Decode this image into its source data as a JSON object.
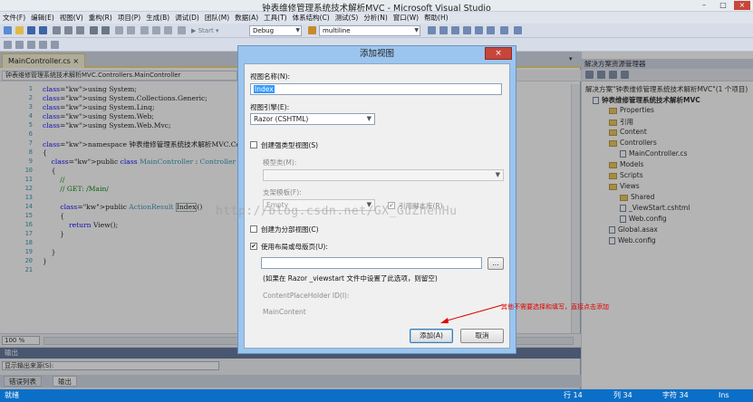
{
  "window": {
    "title": "钟表维修管理系统技术解析MVC - Microsoft Visual Studio",
    "min": "–",
    "max": "□",
    "close": "×"
  },
  "menu": [
    "文件(F)",
    "编辑(E)",
    "视图(V)",
    "重构(R)",
    "项目(P)",
    "生成(B)",
    "调试(D)",
    "团队(M)",
    "数据(A)",
    "工具(T)",
    "体系结构(C)",
    "测试(S)",
    "分析(N)",
    "窗口(W)",
    "帮助(H)"
  ],
  "toolbar": {
    "start_label": "Start",
    "config": "Debug",
    "search": "multiline"
  },
  "editor": {
    "tab_label": "MainController.cs",
    "nav_combo": "钟表维修管理系统技术解析MVC.Controllers.MainController",
    "zoom": "100 %",
    "lines": [
      {
        "n": "1",
        "t": "using System;"
      },
      {
        "n": "2",
        "t": "using System.Collections.Generic;"
      },
      {
        "n": "3",
        "t": "using System.Linq;"
      },
      {
        "n": "4",
        "t": "using System.Web;"
      },
      {
        "n": "5",
        "t": "using System.Web.Mvc;"
      },
      {
        "n": "6",
        "t": ""
      },
      {
        "n": "7",
        "t": "namespace 钟表维修管理系统技术解析MVC.Controllers"
      },
      {
        "n": "8",
        "t": "{"
      },
      {
        "n": "9",
        "t": "    public class MainController : Controller"
      },
      {
        "n": "10",
        "t": "    {"
      },
      {
        "n": "11",
        "t": "        //"
      },
      {
        "n": "12",
        "t": "        // GET: /Main/"
      },
      {
        "n": "13",
        "t": ""
      },
      {
        "n": "14",
        "t": "        public ActionResult Index()"
      },
      {
        "n": "15",
        "t": "        {"
      },
      {
        "n": "16",
        "t": "            return View();"
      },
      {
        "n": "17",
        "t": "        }"
      },
      {
        "n": "18",
        "t": ""
      },
      {
        "n": "19",
        "t": "    }"
      },
      {
        "n": "20",
        "t": "}"
      },
      {
        "n": "21",
        "t": ""
      }
    ]
  },
  "output": {
    "header": "输出",
    "source_label": "显示输出来源(S):",
    "tabs": [
      "错误列表",
      "输出"
    ]
  },
  "status": {
    "left": "就绪",
    "row": "行 14",
    "col": "列 34",
    "char": "字符 34",
    "mode": "Ins"
  },
  "solution": {
    "header": "解决方案资源管理器",
    "title": "解决方案\"钟表维修管理系统技术解析MVC\"(1 个项目)",
    "project": "钟表维修管理系统技术解析MVC",
    "items": [
      "Properties",
      "引用",
      "Content",
      "Controllers",
      "MainController.cs",
      "Models",
      "Scripts",
      "Views",
      "Shared",
      "_ViewStart.cshtml",
      "Web.config",
      "Global.asax",
      "Web.config"
    ]
  },
  "dialog": {
    "title": "添加视图",
    "close": "×",
    "name_label": "视图名称(N):",
    "name_value": "Index",
    "engine_label": "视图引擎(E):",
    "engine_value": "Razor (CSHTML)",
    "strong_typed": "创建强类型视图(S)",
    "model_label": "模型类(M):",
    "scaffold_label": "支架模板(F):",
    "scaffold_value": "Empty",
    "ref_scripts": "引用脚本库(R)",
    "partial": "创建为分部视图(C)",
    "use_layout": "使用布局或母版页(U):",
    "browse": "...",
    "hint": "(如果在 Razor _viewstart 文件中设置了此选项，则留空)",
    "placeholder_label": "ContentPlaceHolder ID(I):",
    "placeholder_value": "MainContent",
    "add_button": "添加(A)",
    "cancel_button": "取消"
  },
  "watermark": "http://blog.csdn.net/GX_GuZhenHu",
  "annotation": "其他不需要选择和填写，直接点击添加",
  "colors": {
    "status": "#0c6fc7",
    "annotation": "#e10000",
    "dialog_frame": "#9bc5ee"
  }
}
